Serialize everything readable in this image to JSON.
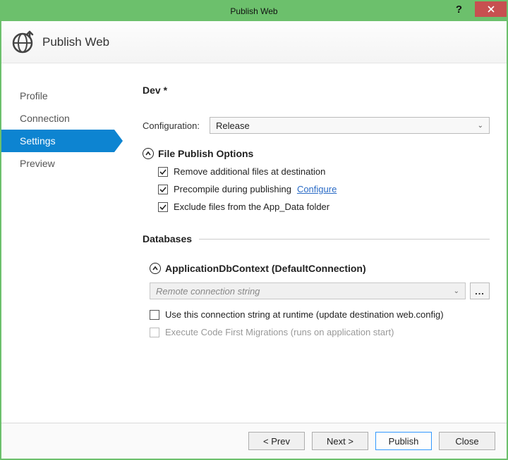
{
  "titlebar": {
    "title": "Publish Web"
  },
  "header": {
    "title": "Publish Web"
  },
  "sidebar": {
    "items": [
      {
        "label": "Profile",
        "active": false
      },
      {
        "label": "Connection",
        "active": false
      },
      {
        "label": "Settings",
        "active": true
      },
      {
        "label": "Preview",
        "active": false
      }
    ]
  },
  "main": {
    "profile_name": "Dev *",
    "configuration_label": "Configuration:",
    "configuration_value": "Release",
    "file_publish": {
      "heading": "File Publish Options",
      "remove_files_label": "Remove additional files at destination",
      "remove_files_checked": true,
      "precompile_label": "Precompile during publishing",
      "precompile_checked": true,
      "precompile_configure_link": "Configure",
      "exclude_appdata_label": "Exclude files from the App_Data folder",
      "exclude_appdata_checked": true
    },
    "databases": {
      "heading": "Databases",
      "context_name": "ApplicationDbContext (DefaultConnection)",
      "conn_placeholder": "Remote connection string",
      "browse_label": "...",
      "use_at_runtime_label": "Use this connection string at runtime (update destination web.config)",
      "use_at_runtime_checked": false,
      "migrations_label": "Execute Code First Migrations (runs on application start)",
      "migrations_checked": false,
      "migrations_enabled": false
    }
  },
  "footer": {
    "prev": "< Prev",
    "next": "Next >",
    "publish": "Publish",
    "close": "Close"
  }
}
